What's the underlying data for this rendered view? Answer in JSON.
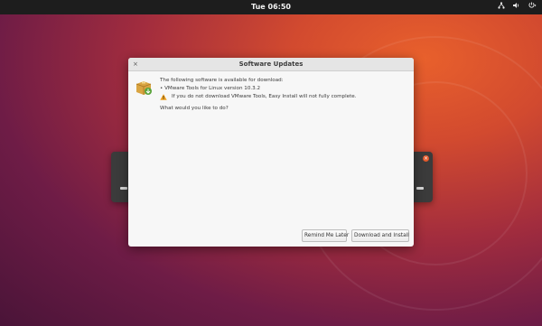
{
  "topbar": {
    "clock": "Tue 06:50",
    "tray": {
      "network_icon": "network-icon",
      "volume_icon": "volume-icon",
      "power_icon": "power-icon"
    }
  },
  "dialog": {
    "title": "Software Updates",
    "close_glyph": "×",
    "message": {
      "intro": "The following software is available for download:",
      "item": "• VMware Tools for Linux version 10.3.2",
      "warning": "If you do not download VMware Tools, Easy Install will not fully complete.",
      "question": "What would you like to do?"
    },
    "buttons": {
      "remind_label": "Remind Me Later",
      "download_label": "Download and Install"
    }
  },
  "colors": {
    "background_accent": "#d24a2f",
    "topbar": "#1d1d1d",
    "dialog_bg": "#f7f7f7",
    "warning": "#f0a11c"
  }
}
